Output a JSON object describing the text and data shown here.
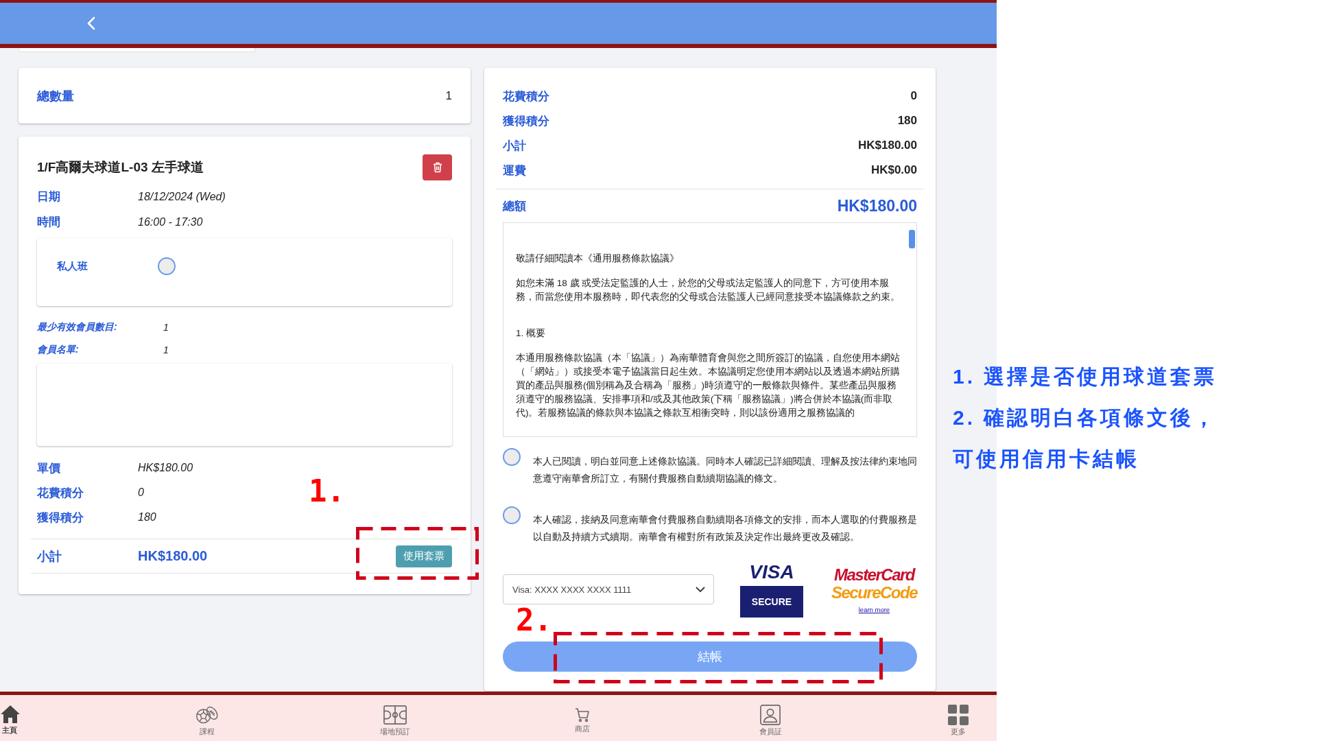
{
  "summary": {
    "label": "總數量",
    "value": "1"
  },
  "booking": {
    "title": "1/F高爾夫球道L-03 左手球道",
    "details": [
      {
        "label": "日期",
        "value": "18/12/2024 (Wed)"
      },
      {
        "label": "時間",
        "value": "16:00 - 17:30"
      }
    ],
    "private_class": {
      "label": "私人班",
      "checked": false
    },
    "members": [
      {
        "label": "最少有效會員數目:",
        "value": "1"
      },
      {
        "label": "會員名單:",
        "value": "1"
      }
    ],
    "prices": [
      {
        "label": "單價",
        "value": "HK$180.00"
      },
      {
        "label": "花費積分",
        "value": "0"
      },
      {
        "label": "獲得積分",
        "value": "180"
      }
    ],
    "subtotal": {
      "label": "小計",
      "value": "HK$180.00"
    },
    "use_ticket_button": "使用套票"
  },
  "order_summary": {
    "rows": [
      {
        "label": "花費積分",
        "value": "0"
      },
      {
        "label": "獲得積分",
        "value": "180"
      },
      {
        "label": "小計",
        "value": "HK$180.00"
      },
      {
        "label": "運費",
        "value": "HK$0.00"
      }
    ],
    "total": {
      "label": "總額",
      "value": "HK$180.00"
    },
    "terms": [
      {
        "kind": "paragraph",
        "text": "敬請仔細閱讀本《通用服務條款協議》"
      },
      {
        "kind": "paragraph",
        "text": "如您未滿 18 歲 或受法定監護的人士，於您的父母或法定監護人的同意下，方可使用本服務，而當您使用本服務時，即代表您的父母或合法監護人已經同意接受本協議條款之約束。"
      },
      {
        "kind": "heading",
        "text": "1. 概要"
      },
      {
        "kind": "paragraph",
        "text": "本通用服務條款協議（本「協議」）為南華體育會與您之間所簽訂的協議，自您使用本網站（「網站」）或接受本電子協議當日起生效。本協議明定您使用本網站以及透過本網站所購買的產品與服務(個別稱為及合稱為「服務」)時須遵守的一般條款與條件。某些產品與服務須遵守的服務協議、安排事項和/或及其他政策(下稱「服務協議」)將合併於本協議(而非取代)。若服務協議的條款與本協議之條款互相衝突時，則以該份適用之服務協議的"
      }
    ],
    "agreements": [
      {
        "text": "本人已閱讀，明白並同意上述條款協議。同時本人確認已詳細閱讀、理解及按法律約束地同意遵守南華會所訂立，有關付費服務自動續期協議的條文。",
        "checked": false
      },
      {
        "text": "本人確認，接納及同意南華會付費服務自動續期各項條文的安排，而本人選取的付費服務是以自動及持續方式續期。南華會有權對所有政策及決定作出最終更改及確認。",
        "checked": false
      }
    ],
    "card_select": {
      "value": "Visa: XXXX XXXX XXXX 1111"
    },
    "visa_secure": {
      "brand": "VISA",
      "badge": "SECURE"
    },
    "mastercard_securecode": {
      "line_1": "MasterCard",
      "line_2": "SecureCode",
      "link": "learn more"
    },
    "checkout_button": "結帳"
  },
  "bottom_nav": [
    {
      "label": "主頁",
      "selected": true
    },
    {
      "label": "課程",
      "selected": false
    },
    {
      "label": "場地預訂",
      "selected": false
    },
    {
      "label": "商店",
      "selected": false
    },
    {
      "label": "會員証",
      "selected": false
    },
    {
      "label": "更多",
      "selected": false
    }
  ],
  "annotations": {
    "markers": [
      "1.",
      "2."
    ],
    "notes": [
      "1. 選擇是否使用球道套票",
      "2. 確認明白各項條文後，",
      "可使用信用卡結帳"
    ]
  }
}
